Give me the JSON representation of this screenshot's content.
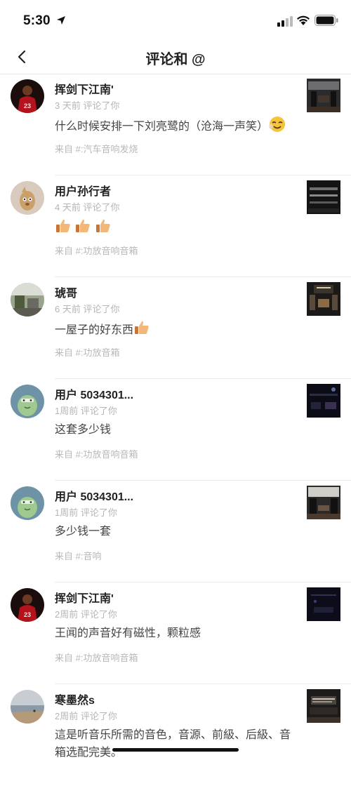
{
  "status_bar": {
    "time": "5:30",
    "icons": [
      "location-arrow-icon",
      "signal-icon",
      "wifi-icon",
      "battery-icon"
    ]
  },
  "nav": {
    "title": "评论和 @",
    "back_icon": "chevron-left-icon"
  },
  "items": [
    {
      "name": "挥剑下江南'",
      "meta": "3 天前 评论了你",
      "content": "什么时候安排一下刘亮鹭的（沧海一声笑）",
      "emoji": "laughing-face",
      "source": "来自 #:汽车音响发烧"
    },
    {
      "name": "用户孙行者",
      "meta": "4 天前 评论了你",
      "content": "",
      "emoji": "thumbs-up x3",
      "source": "来自 #:功放音响音箱"
    },
    {
      "name": "琥哥",
      "meta": "6 天前 评论了你",
      "content": "一屋子的好东西",
      "emoji": "thumbs-up",
      "source": "来自 #:功放音箱"
    },
    {
      "name": "用户 5034301...",
      "meta": "1周前 评论了你",
      "content": "这套多少钱",
      "source": "来自 #:功放音响音箱"
    },
    {
      "name": "用户 5034301...",
      "meta": "1周前 评论了你",
      "content": "多少钱一套",
      "source": "来自 #:音响"
    },
    {
      "name": "挥剑下江南'",
      "meta": "2周前 评论了你",
      "content": "王闻的声音好有磁性，颗粒感",
      "source": "来自 #:功放音响音箱"
    },
    {
      "name": "寒墨然s",
      "meta": "2周前 评论了你",
      "content": "這是听音乐所需的音色，音源、前級、后級、音箱选配完美。",
      "source": ""
    }
  ],
  "colors": {
    "meta_gray": "#b5b5b5",
    "divider": "#ececec",
    "title": "#222222"
  }
}
